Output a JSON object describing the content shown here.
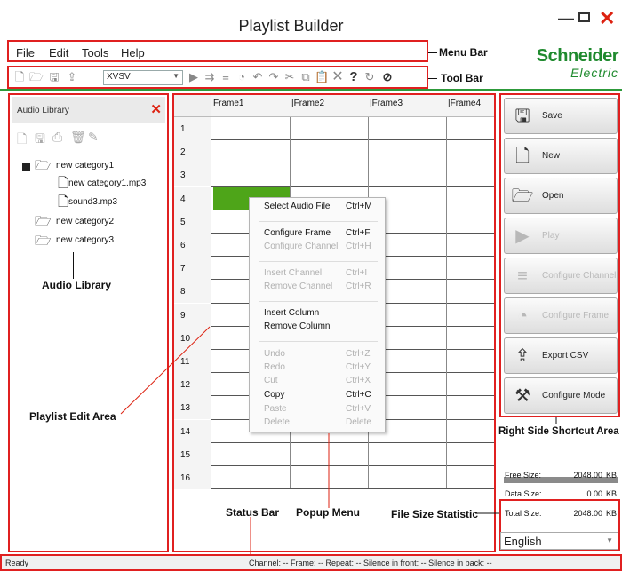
{
  "window": {
    "title": "Playlist Builder",
    "minimize": "—",
    "close": "✕"
  },
  "menubar": {
    "items": [
      "File",
      "Edit",
      "Tools",
      "Help"
    ]
  },
  "annotations": {
    "menu_bar": "Menu Bar",
    "tool_bar": "Tool Bar",
    "audio_library": "Audio Library",
    "playlist_edit_area": "Playlist Edit Area",
    "status_bar": "Status Bar",
    "popup_menu": "Popup Menu",
    "file_size_statistic": "File Size Statistic",
    "right_side_shortcut_area": "Right Side Shortcut Area"
  },
  "logo": {
    "line1": "Schneider",
    "line2": "Electric"
  },
  "toolbar": {
    "mode_select": "XVSV"
  },
  "library": {
    "title": "Audio Library",
    "tree": [
      {
        "label": "new category1"
      },
      {
        "label": "new category1.mp3"
      },
      {
        "label": "sound3.mp3"
      },
      {
        "label": "new category2"
      },
      {
        "label": "new category3"
      }
    ]
  },
  "grid": {
    "columns": [
      "Frame1",
      "|Frame2",
      "|Frame3",
      "|Frame4"
    ],
    "rows": [
      "1",
      "2",
      "3",
      "4",
      "5",
      "6",
      "7",
      "8",
      "9",
      "10",
      "11",
      "12",
      "13",
      "14",
      "15",
      "16"
    ]
  },
  "popup": {
    "items": [
      {
        "label": "Select Audio File",
        "shortcut": "Ctrl+M",
        "enabled": true
      },
      {
        "label": "Configure Frame",
        "shortcut": "Ctrl+F",
        "enabled": true
      },
      {
        "label": "Configure Channel",
        "shortcut": "Ctrl+H",
        "enabled": false
      },
      {
        "label": "Insert Channel",
        "shortcut": "Ctrl+I",
        "enabled": false
      },
      {
        "label": "Remove Channel",
        "shortcut": "Ctrl+R",
        "enabled": false
      },
      {
        "label": "Insert Column",
        "shortcut": "",
        "enabled": true
      },
      {
        "label": "Remove Column",
        "shortcut": "",
        "enabled": true
      },
      {
        "label": "Undo",
        "shortcut": "Ctrl+Z",
        "enabled": false
      },
      {
        "label": "Redo",
        "shortcut": "Ctrl+Y",
        "enabled": false
      },
      {
        "label": "Cut",
        "shortcut": "Ctrl+X",
        "enabled": false
      },
      {
        "label": "Copy",
        "shortcut": "Ctrl+C",
        "enabled": true
      },
      {
        "label": "Paste",
        "shortcut": "Ctrl+V",
        "enabled": false
      },
      {
        "label": "Delete",
        "shortcut": "Delete",
        "enabled": false
      }
    ]
  },
  "shortcuts": [
    {
      "label": "Save",
      "icon": "save-icon",
      "enabled": true
    },
    {
      "label": "New",
      "icon": "new-file-icon",
      "enabled": true
    },
    {
      "label": "Open",
      "icon": "open-folder-icon",
      "enabled": true
    },
    {
      "label": "Play",
      "icon": "play-icon",
      "enabled": false
    },
    {
      "label": "Configure Channel",
      "icon": "channel-icon",
      "enabled": false
    },
    {
      "label": "Configure Frame",
      "icon": "frame-icon",
      "enabled": false
    },
    {
      "label": "Export CSV",
      "icon": "export-icon",
      "enabled": true
    },
    {
      "label": "Configure Mode",
      "icon": "tools-icon",
      "enabled": true
    }
  ],
  "filesize": {
    "rows": [
      {
        "label": "Free Size:",
        "value": "2048.00",
        "unit": "KB"
      },
      {
        "label": "Data Size:",
        "value": "0.00",
        "unit": "KB"
      },
      {
        "label": "Total Size:",
        "value": "2048.00",
        "unit": "KB"
      }
    ]
  },
  "language": "English",
  "status": {
    "ready": "Ready",
    "info": "Channel: --  Frame: --  Repeat: --  Silence in front: --  Silence in back: --"
  },
  "colors": {
    "accent_green": "#2d9a3a",
    "annotation_red": "#e02020",
    "selected_cell": "#4ea519"
  }
}
